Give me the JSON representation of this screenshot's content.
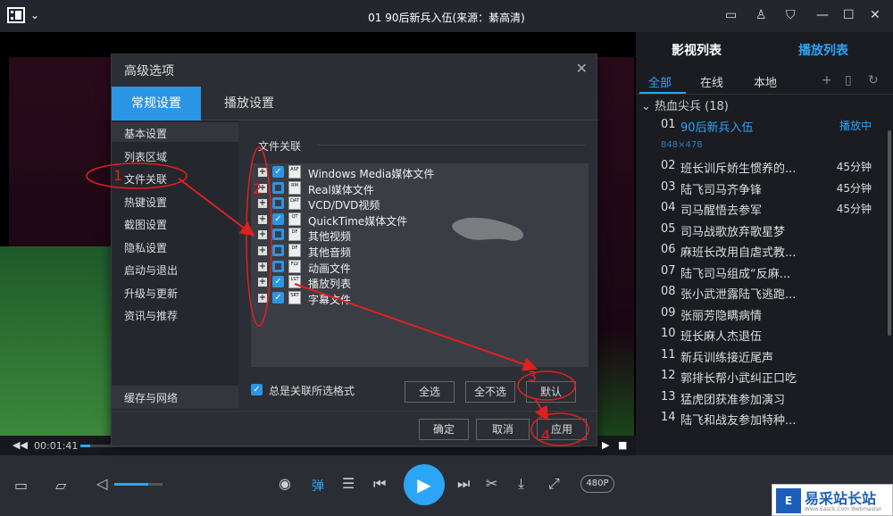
{
  "window": {
    "title": "01 90后新兵入伍(来源：綦高清)"
  },
  "playlist_panel": {
    "tab_video_list": "影视列表",
    "tab_play_list": "播放列表",
    "filters": [
      "全部",
      "在线",
      "本地"
    ],
    "group": "热血尖兵 (18)",
    "resolution": "848×478",
    "items": [
      {
        "num": "01",
        "name": "90后新兵入伍",
        "duration": "播放中",
        "playing": true
      },
      {
        "num": "02",
        "name": "班长训斥娇生惯养的...",
        "duration": "45分钟"
      },
      {
        "num": "03",
        "name": "陆飞司马齐争锋",
        "duration": "45分钟"
      },
      {
        "num": "04",
        "name": "司马醒悟去参军",
        "duration": "45分钟"
      },
      {
        "num": "05",
        "name": "司马战歌放弃歌星梦",
        "duration": ""
      },
      {
        "num": "06",
        "name": "麻班长改用自虐式教...",
        "duration": ""
      },
      {
        "num": "07",
        "name": "陆飞司马组成“反麻...",
        "duration": ""
      },
      {
        "num": "08",
        "name": "张小武泄露陆飞逃跑...",
        "duration": ""
      },
      {
        "num": "09",
        "name": "张丽芳隐瞒病情",
        "duration": ""
      },
      {
        "num": "10",
        "name": "班长麻人杰退伍",
        "duration": ""
      },
      {
        "num": "11",
        "name": "新兵训练接近尾声",
        "duration": ""
      },
      {
        "num": "12",
        "name": "郭排长帮小武纠正口吃",
        "duration": ""
      },
      {
        "num": "13",
        "name": "猛虎团获准参加演习",
        "duration": ""
      },
      {
        "num": "14",
        "name": "陆飞和战友参加特种...",
        "duration": ""
      }
    ]
  },
  "player": {
    "time": "00:01:41",
    "progress": 0.02,
    "volume": 0.7,
    "danmu_label": "弹",
    "quality": "480P"
  },
  "dialog": {
    "title": "高级选项",
    "tabs": [
      "常规设置",
      "播放设置"
    ],
    "sidebar": [
      "基本设置",
      "列表区域",
      "文件关联",
      "热键设置",
      "截图设置",
      "隐私设置",
      "启动与退出",
      "升级与更新",
      "资讯与推荐"
    ],
    "sidebar_bottom": "缓存与网络",
    "section_title": "文件关联",
    "file_types": [
      {
        "label": "Windows Media媒体文件",
        "icon": "ASF",
        "checked": true
      },
      {
        "label": "Real媒体文件",
        "icon": "RM",
        "checked": false
      },
      {
        "label": "VCD/DVD视频",
        "icon": "DAT",
        "checked": false
      },
      {
        "label": "QuickTime媒体文件",
        "icon": "QT",
        "checked": true
      },
      {
        "label": "其他视频",
        "icon": "DF",
        "checked": false
      },
      {
        "label": "其他音频",
        "icon": "DF",
        "checked": false
      },
      {
        "label": "动画文件",
        "icon": "FLV",
        "checked": false
      },
      {
        "label": "播放列表",
        "icon": "LST",
        "checked": true
      },
      {
        "label": "字幕文件",
        "icon": "SRT",
        "checked": true
      }
    ],
    "always_associate": "总是关联所选格式",
    "btn_select_all": "全选",
    "btn_select_none": "全不选",
    "btn_default": "默认",
    "btn_ok": "确定",
    "btn_cancel": "取消",
    "btn_apply": "应用"
  },
  "annotations": {
    "a1": "1",
    "a2": "2",
    "a3": "3",
    "a4": "4",
    "color": "#e02020"
  },
  "watermark": {
    "logo": "E",
    "text": "易采站长站",
    "sub": "Www.Easck.Com Webmaster"
  }
}
